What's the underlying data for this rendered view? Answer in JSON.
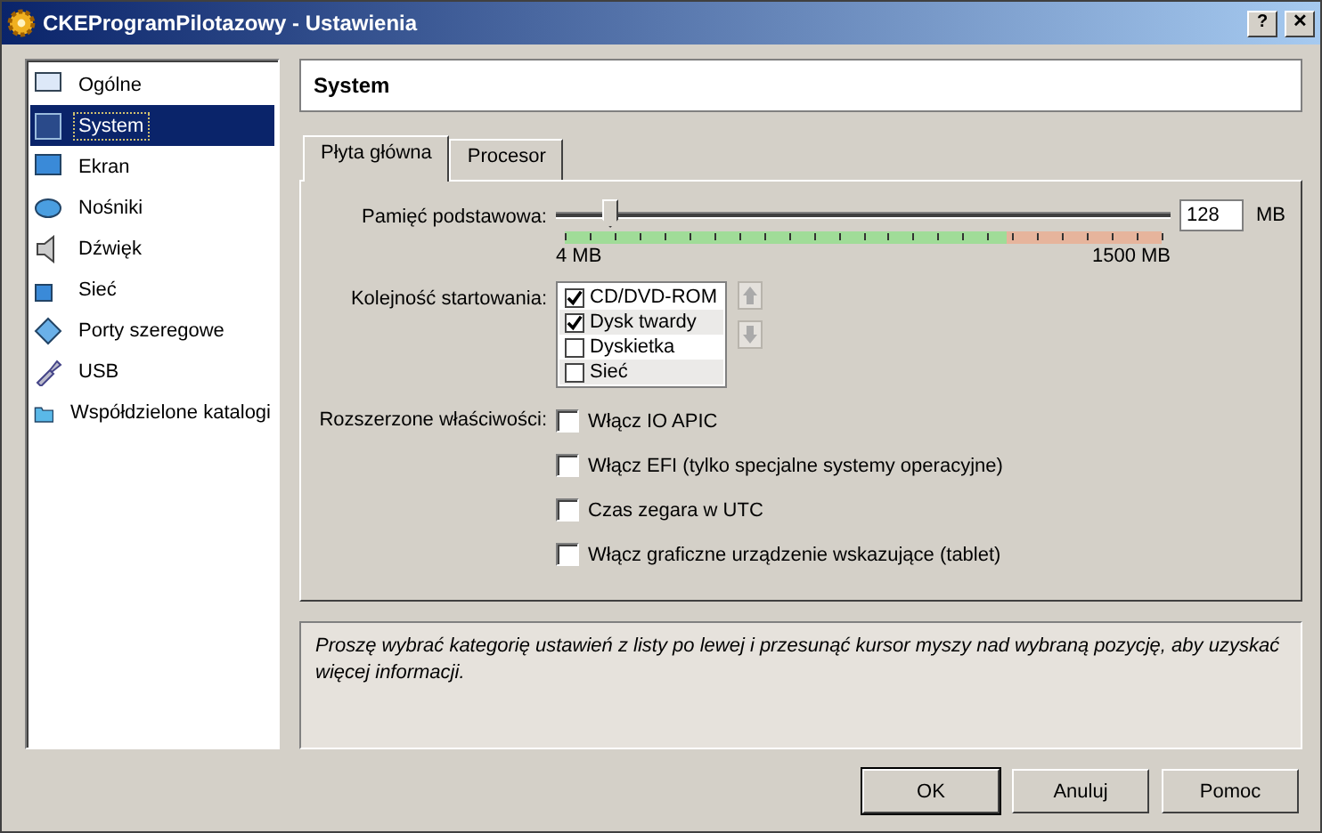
{
  "window": {
    "title": "CKEProgramPilotazowy - Ustawienia",
    "buttons": [
      "?",
      "✕"
    ]
  },
  "sidebar": {
    "items": [
      {
        "label": "Ogólne",
        "selected": false
      },
      {
        "label": "System",
        "selected": true
      },
      {
        "label": "Ekran",
        "selected": false
      },
      {
        "label": "Nośniki",
        "selected": false
      },
      {
        "label": "Dźwięk",
        "selected": false
      },
      {
        "label": "Sieć",
        "selected": false
      },
      {
        "label": "Porty szeregowe",
        "selected": false
      },
      {
        "label": "USB",
        "selected": false
      },
      {
        "label": "Współdzielone katalogi",
        "selected": false
      }
    ]
  },
  "header": "System",
  "tabs": [
    {
      "label": "Płyta główna",
      "selected": true
    },
    {
      "label": "Procesor",
      "selected": false
    }
  ],
  "memory": {
    "label": "Pamięć podstawowa:",
    "level": 0.09,
    "value": "128",
    "unit": "MB",
    "min_label": "4 MB",
    "max_label": "1500 MB"
  },
  "boot_order": {
    "label": "Kolejność startowania:",
    "items": [
      {
        "label": "CD/DVD-ROM",
        "checked": true
      },
      {
        "label": "Dysk twardy",
        "checked": true
      },
      {
        "label": "Dyskietka",
        "checked": false
      },
      {
        "label": "Sieć",
        "checked": false
      }
    ]
  },
  "extended": {
    "label": "Rozszerzone właściwości:",
    "options": [
      {
        "label": "Włącz IO APIC",
        "checked": false
      },
      {
        "label": "Włącz EFI (tylko specjalne systemy operacyjne)",
        "checked": false
      },
      {
        "label": "Czas zegara w UTC",
        "checked": false
      },
      {
        "label": "Włącz graficzne urządzenie wskazujące (tablet)",
        "checked": false
      }
    ]
  },
  "info": "Proszę wybrać kategorię ustawień z listy po lewej i przesunąć kursor myszy nad wybraną pozycję, aby uzyskać więcej informacji.",
  "buttons": [
    "OK",
    "Anuluj",
    "Pomoc"
  ]
}
